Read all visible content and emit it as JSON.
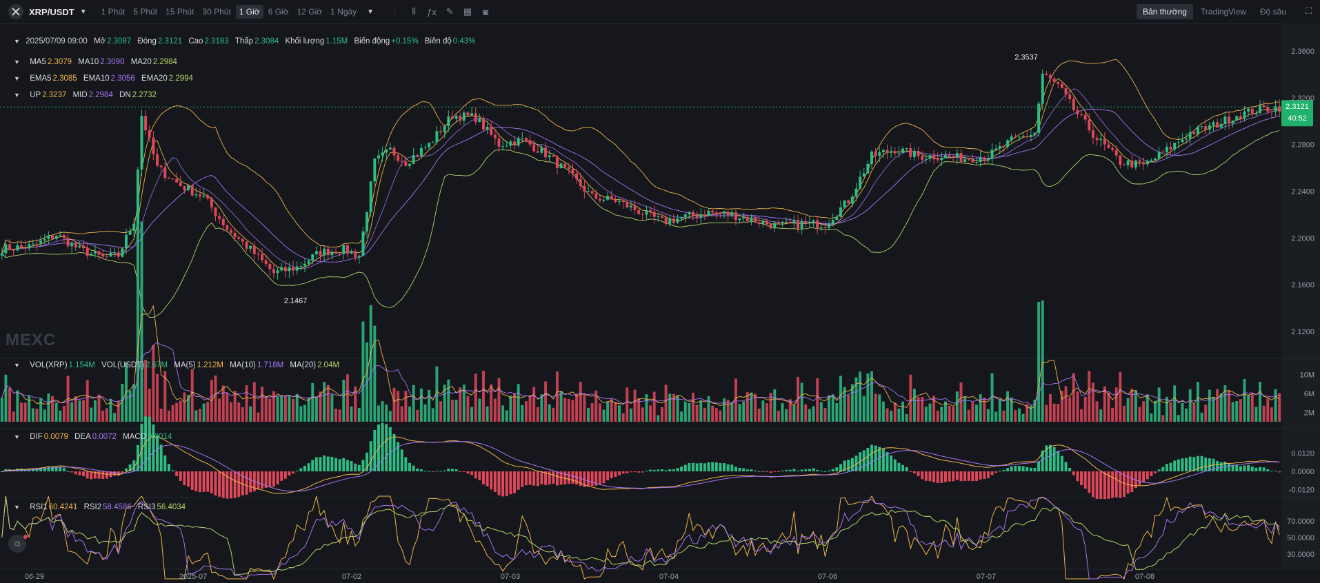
{
  "toolbar": {
    "pair": "XRP/USDT",
    "timeframes": [
      "1 Phút",
      "5 Phút",
      "15 Phút",
      "30 Phút",
      "1 Giờ",
      "6 Giờ",
      "12 Giờ",
      "1 Ngày"
    ],
    "active_timeframe": "1 Giờ",
    "views": [
      "Bản thường",
      "TradingView",
      "Độ sâu"
    ],
    "active_view": "Bản thường",
    "icons": [
      "candle-type-icon",
      "indicator-icon",
      "draw-icon",
      "layout-icon",
      "camera-icon",
      "fullscreen-icon"
    ]
  },
  "ohlc": {
    "date": "2025/07/09 09:00",
    "open_label": "Mở",
    "open": "2.3087",
    "close_label": "Đóng",
    "close": "2.3121",
    "high_label": "Cao",
    "high": "2.3183",
    "low_label": "Thấp",
    "low": "2.3084",
    "volume_label": "Khối lượng",
    "volume": "1.15M",
    "change_label": "Biến động",
    "change": "+0.15%",
    "amplitude_label": "Biên độ",
    "amplitude": "0.43%"
  },
  "ma": {
    "ma5_label": "MA5",
    "ma5": "2.3079",
    "ma10_label": "MA10",
    "ma10": "2.3090",
    "ma20_label": "MA20",
    "ma20": "2.2984"
  },
  "ema": {
    "ema5_label": "EMA5",
    "ema5": "2.3085",
    "ema10_label": "EMA10",
    "ema10": "2.3056",
    "ema20_label": "EMA20",
    "ema20": "2.2994"
  },
  "boll": {
    "up_label": "UP",
    "up": "2.3237",
    "mid_label": "MID",
    "mid": "2.2984",
    "dn_label": "DN",
    "dn": "2.2732"
  },
  "vol": {
    "vol_xrp_label": "VOL(XRP)",
    "vol_xrp": "1.154M",
    "vol_usdt_label": "VOL(USDT)",
    "vol_usdt": "2.67M",
    "ma5_label": "MA(5)",
    "ma5": "1.212M",
    "ma10_label": "MA(10)",
    "ma10": "1.718M",
    "ma20_label": "MA(20)",
    "ma20": "2.04M"
  },
  "macd": {
    "dif_label": "DIF",
    "dif": "0.0079",
    "dea_label": "DEA",
    "dea": "0.0072",
    "macd_label": "MACD",
    "macd": "0.0014"
  },
  "rsi": {
    "rsi1_label": "RSI1",
    "rsi1": "60.4241",
    "rsi2_label": "RSI2",
    "rsi2": "58.4586",
    "rsi3_label": "RSI3",
    "rsi3": "56.4034"
  },
  "watermark": "MEXC",
  "colors": {
    "up": "#2ebd85",
    "down": "#e0485a",
    "ma5": "#f0b54b",
    "ma10": "#a776f5",
    "ma20": "#b7d36b",
    "price_tag": "#20b26c"
  },
  "chart_data": [
    {
      "type": "candlestick",
      "title": "XRP/USDT 1 Giờ",
      "x_ticks": [
        "06-29",
        "2025-07",
        "07-02",
        "07-03",
        "07-04",
        "07-06",
        "07-07",
        "07-08"
      ],
      "y_ticks": [
        "2.3600",
        "2.3200",
        "2.2800",
        "2.2400",
        "2.2000",
        "2.1600",
        "2.1200"
      ],
      "ylim": [
        2.1,
        2.38
      ],
      "current_price": "2.3121",
      "countdown": "40:52",
      "high_marker": "2.3537",
      "low_marker": "2.1467",
      "close_path_anchors": [
        [
          0,
          2.191
        ],
        [
          8,
          2.193
        ],
        [
          14,
          2.203
        ],
        [
          20,
          2.19
        ],
        [
          26,
          2.183
        ],
        [
          30,
          2.185
        ],
        [
          34,
          2.215
        ],
        [
          36,
          2.305
        ],
        [
          40,
          2.26
        ],
        [
          46,
          2.245
        ],
        [
          52,
          2.235
        ],
        [
          58,
          2.208
        ],
        [
          64,
          2.19
        ],
        [
          70,
          2.17
        ],
        [
          76,
          2.175
        ],
        [
          82,
          2.188
        ],
        [
          88,
          2.19
        ],
        [
          92,
          2.185
        ],
        [
          96,
          2.265
        ],
        [
          100,
          2.275
        ],
        [
          104,
          2.265
        ],
        [
          110,
          2.28
        ],
        [
          116,
          2.305
        ],
        [
          122,
          2.303
        ],
        [
          128,
          2.28
        ],
        [
          134,
          2.284
        ],
        [
          140,
          2.272
        ],
        [
          146,
          2.255
        ],
        [
          152,
          2.235
        ],
        [
          158,
          2.232
        ],
        [
          164,
          2.223
        ],
        [
          170,
          2.214
        ],
        [
          176,
          2.218
        ],
        [
          182,
          2.222
        ],
        [
          188,
          2.22
        ],
        [
          194,
          2.215
        ],
        [
          200,
          2.21
        ],
        [
          206,
          2.212
        ],
        [
          212,
          2.212
        ],
        [
          218,
          2.232
        ],
        [
          224,
          2.27
        ],
        [
          230,
          2.276
        ],
        [
          236,
          2.27
        ],
        [
          242,
          2.27
        ],
        [
          248,
          2.268
        ],
        [
          254,
          2.27
        ],
        [
          260,
          2.283
        ],
        [
          266,
          2.29
        ],
        [
          268,
          2.34
        ],
        [
          272,
          2.33
        ],
        [
          276,
          2.31
        ],
        [
          282,
          2.285
        ],
        [
          288,
          2.265
        ],
        [
          294,
          2.262
        ],
        [
          300,
          2.275
        ],
        [
          306,
          2.29
        ],
        [
          312,
          2.296
        ],
        [
          318,
          2.305
        ],
        [
          324,
          2.31
        ],
        [
          329,
          2.312
        ]
      ],
      "volume_ticks": [
        "10M",
        "6M",
        "2M"
      ],
      "macd_ticks": [
        "0.0120",
        "0.0000",
        "-0.0120"
      ],
      "rsi_ticks": [
        "70.0000",
        "50.0000",
        "30.0000"
      ]
    }
  ]
}
